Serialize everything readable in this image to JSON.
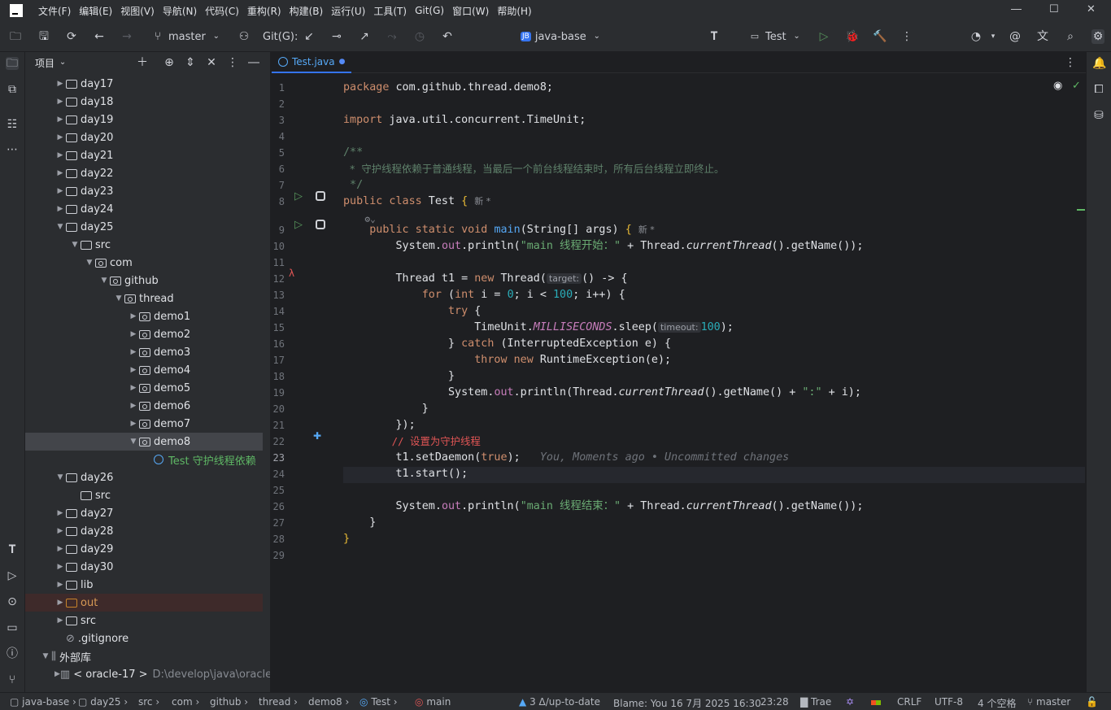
{
  "menu": [
    "文件(F)",
    "编辑(E)",
    "视图(V)",
    "导航(N)",
    "代码(C)",
    "重构(R)",
    "构建(B)",
    "运行(U)",
    "工具(T)",
    "Git(G)",
    "窗口(W)",
    "帮助(H)"
  ],
  "toolbar": {
    "branch": "master",
    "git_label": "Git(G):",
    "project_badge": "JB",
    "project_name": "java-base",
    "run_config": "Test"
  },
  "project_panel": {
    "title": "项目"
  },
  "tree": [
    {
      "label": "day17",
      "arrow": "▶"
    },
    {
      "label": "day18",
      "arrow": "▶"
    },
    {
      "label": "day19",
      "arrow": "▶"
    },
    {
      "label": "day20",
      "arrow": "▶"
    },
    {
      "label": "day21",
      "arrow": "▶"
    },
    {
      "label": "day22",
      "arrow": "▶"
    },
    {
      "label": "day23",
      "arrow": "▶"
    },
    {
      "label": "day24",
      "arrow": "▶"
    },
    {
      "label": "day25",
      "arrow": "▼"
    },
    {
      "label": "src",
      "arrow": "▼"
    },
    {
      "label": "com",
      "arrow": "▼"
    },
    {
      "label": "github",
      "arrow": "▼"
    },
    {
      "label": "thread",
      "arrow": "▼"
    },
    {
      "label": "demo1",
      "arrow": "▶"
    },
    {
      "label": "demo2",
      "arrow": "▶"
    },
    {
      "label": "demo3",
      "arrow": "▶"
    },
    {
      "label": "demo4",
      "arrow": "▶"
    },
    {
      "label": "demo5",
      "arrow": "▶"
    },
    {
      "label": "demo6",
      "arrow": "▶"
    },
    {
      "label": "demo7",
      "arrow": "▶"
    },
    {
      "label": "demo8",
      "arrow": "▼"
    },
    {
      "label": "Test 守护线程依赖",
      "arrow": ""
    },
    {
      "label": "day26",
      "arrow": "▼"
    },
    {
      "label": "src",
      "arrow": ""
    },
    {
      "label": "day27",
      "arrow": "▶"
    },
    {
      "label": "day28",
      "arrow": "▶"
    },
    {
      "label": "day29",
      "arrow": "▶"
    },
    {
      "label": "day30",
      "arrow": "▶"
    },
    {
      "label": "lib",
      "arrow": "▶"
    },
    {
      "label": "out",
      "arrow": "▶"
    },
    {
      "label": "src",
      "arrow": "▶"
    },
    {
      "label": ".gitignore",
      "arrow": ""
    },
    {
      "label": "外部库",
      "arrow": "▼"
    },
    {
      "label": "< oracle-17 >",
      "arrow": "▶",
      "path": "D:\\develop\\java\\oracle\\jdk"
    }
  ],
  "editor": {
    "tab": "Test.java",
    "line_numbers": [
      "1",
      "2",
      "3",
      "4",
      "5",
      "6",
      "7",
      "8",
      "9",
      "10",
      "11",
      "12",
      "13",
      "14",
      "15",
      "16",
      "17",
      "18",
      "19",
      "20",
      "21",
      "22",
      "23",
      "24",
      "25",
      "26",
      "27",
      "28",
      "29"
    ],
    "code": {
      "l1a": "package",
      "l1b": " com.github.thread.demo8;",
      "l3a": "import",
      "l3b": " java.util.concurrent.TimeUnit;",
      "l5": "/**",
      "l6": " * 守护线程依赖于普通线程，当最后一个前台线程结束时，所有后台线程立即终止。",
      "l7": " */",
      "l8a": "public class",
      "l8b": " Test ",
      "l8c": "{",
      "l8n": "新 *",
      "l9a": "    public static void ",
      "l9b": "main",
      "l9c": "(String[] args) ",
      "l9d": "{",
      "l9n": "新 *",
      "l10a": "        System.",
      "l10b": "out",
      "l10c": ".println(",
      "l10d": "\"main 线程开始：\"",
      "l10e": " + Thread.",
      "l10f": "currentThread",
      "l10g": "().getName());",
      "l12a": "        Thread t1 = ",
      "l12b": "new",
      "l12c": " Thread(",
      "l12h": "target:",
      "l12d": "() -> {",
      "l13a": "            ",
      "l13b": "for",
      "l13c": " (",
      "l13d": "int",
      "l13e": " i = ",
      "l13f": "0",
      "l13g": "; i < ",
      "l13h": "100",
      "l13i": "; i++) {",
      "l14a": "                ",
      "l14b": "try",
      "l14c": " {",
      "l15a": "                    TimeUnit.",
      "l15b": "MILLISECONDS",
      "l15c": ".sleep(",
      "l15h": "timeout:",
      "l15d": "100",
      "l15e": ");",
      "l16a": "                } ",
      "l16b": "catch",
      "l16c": " (InterruptedException e) {",
      "l17a": "                    ",
      "l17b": "throw new",
      "l17c": " RuntimeException(e);",
      "l18": "                }",
      "l19a": "                System.",
      "l19b": "out",
      "l19c": ".println(Thread.",
      "l19d": "currentThread",
      "l19e": "().getName() + ",
      "l19f": "\":\"",
      "l19g": " + i);",
      "l20": "            }",
      "l21": "        });",
      "l22": "        // 设置为守护线程",
      "l23a": "        t1.setDaemon(",
      "l23b": "true",
      "l23c": ");",
      "l23d": "   You, Moments ago • Uncommitted changes",
      "l24": "        t1.start();",
      "l26a": "        System.",
      "l26b": "out",
      "l26c": ".println(",
      "l26d": "\"main 线程结束：\"",
      "l26e": " + Thread.",
      "l26f": "currentThread",
      "l26g": "().getName());",
      "l27": "    }",
      "l28": "}"
    }
  },
  "status": {
    "crumbs": [
      "java-base",
      "day25",
      "src",
      "com",
      "github",
      "thread",
      "demo8",
      "Test",
      "main"
    ],
    "git_info": "3 Δ/up-to-date",
    "blame": "Blame: You 16 7月 2025 16:30",
    "position": "23:28",
    "plugin": "Trae",
    "line_sep": "CRLF",
    "encoding": "UTF-8",
    "indent": "4 个空格",
    "branch": "master"
  },
  "colors": {
    "accent": "#3574f0",
    "run_green": "#57965c",
    "keyword": "#cf8e6d",
    "string": "#6aab73",
    "number": "#2aacb8"
  }
}
